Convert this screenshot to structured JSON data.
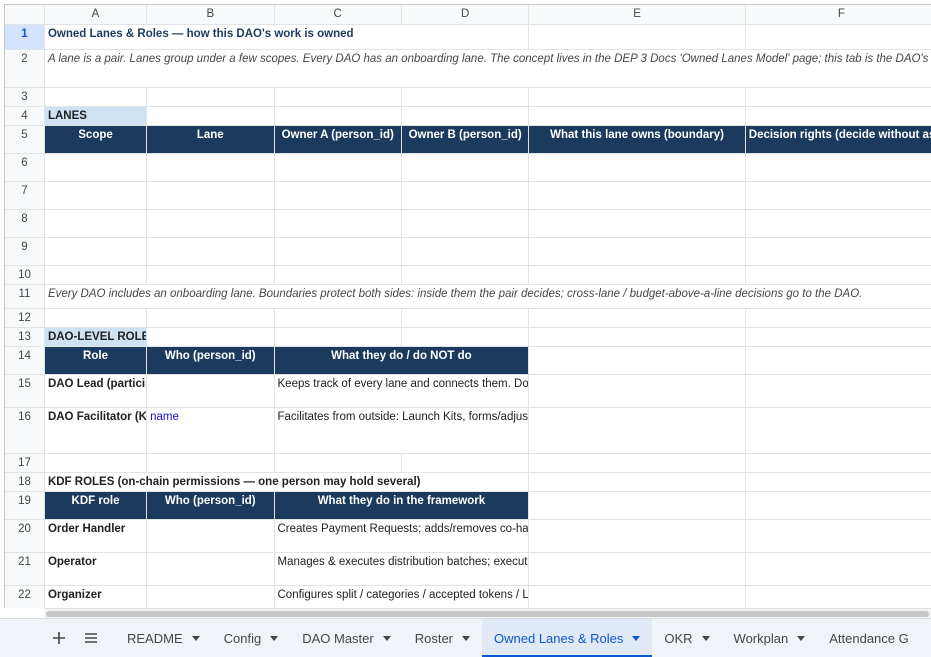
{
  "columns": [
    "A",
    "B",
    "C",
    "D",
    "E",
    "F"
  ],
  "title": "Owned Lanes & Roles — how this DAO's work is owned",
  "intro_note": "A lane is a pair. Lanes group under a few scopes. Every DAO has an onboarding lane. The concept lives in the DEP 3 Docs 'Owned Lanes Model' page; this tab is the DAO's concrete map. Names here feed the Roster, OKR, Workplan and Contributions tabs.",
  "lanes": {
    "label": "LANES",
    "headers": [
      "Scope",
      "Lane",
      "Owner A (person_id)",
      "Owner B (person_id)",
      "What this lane owns (boundary)",
      "Decision rights (decide without asking)"
    ],
    "footnote": "Every DAO includes an onboarding lane. Boundaries protect both sides: inside them the pair decides; cross-lane / budget-above-a-line decisions go to the DAO."
  },
  "dao_roles": {
    "label": "DAO-LEVEL ROLES",
    "headers": [
      "Role",
      "Who (person_id)",
      "What they do / do NOT do"
    ],
    "rows": [
      {
        "role": "DAO Lead (participant)",
        "who": "",
        "desc": "Keeps track of every lane and connects them. Does NOT assign tasks or override a lane."
      },
      {
        "role": "DAO Facilitator (Kambria)",
        "who": "name",
        "desc": "Facilitates from outside: Launch Kits, forms/adjusts pairs, runs check-ins & syncs. Does NOT execute."
      }
    ]
  },
  "kdf_roles": {
    "label": "KDF ROLES (on-chain permissions — one person may hold several)",
    "headers": [
      "KDF role",
      "Who (person_id)",
      "What they do in the framework"
    ],
    "rows": [
      {
        "role": "Order Handler",
        "who": "",
        "desc": "Creates Payment Requests; adds/removes co-handlers; marks orders completed."
      },
      {
        "role": "Operator",
        "who": "",
        "desc": "Manages & executes distribution batches; executes Microjob payments."
      },
      {
        "role": "Organizer",
        "who": "",
        "desc": "Configures split / categories / accepted tokens / LP; manages members & grants Operator."
      }
    ]
  },
  "tabs": [
    "README",
    "Config",
    "DAO Master",
    "Roster",
    "Owned Lanes & Roles",
    "OKR",
    "Workplan",
    "Attendance G"
  ],
  "active_tab": "Owned Lanes & Roles",
  "icons": {
    "add_sheet": "plus-icon",
    "all_sheets": "menu-icon"
  },
  "colors": {
    "header_navy": "#1c3a5e",
    "section_blue": "#cfe2f3",
    "active_tab": "#0b57d0"
  }
}
